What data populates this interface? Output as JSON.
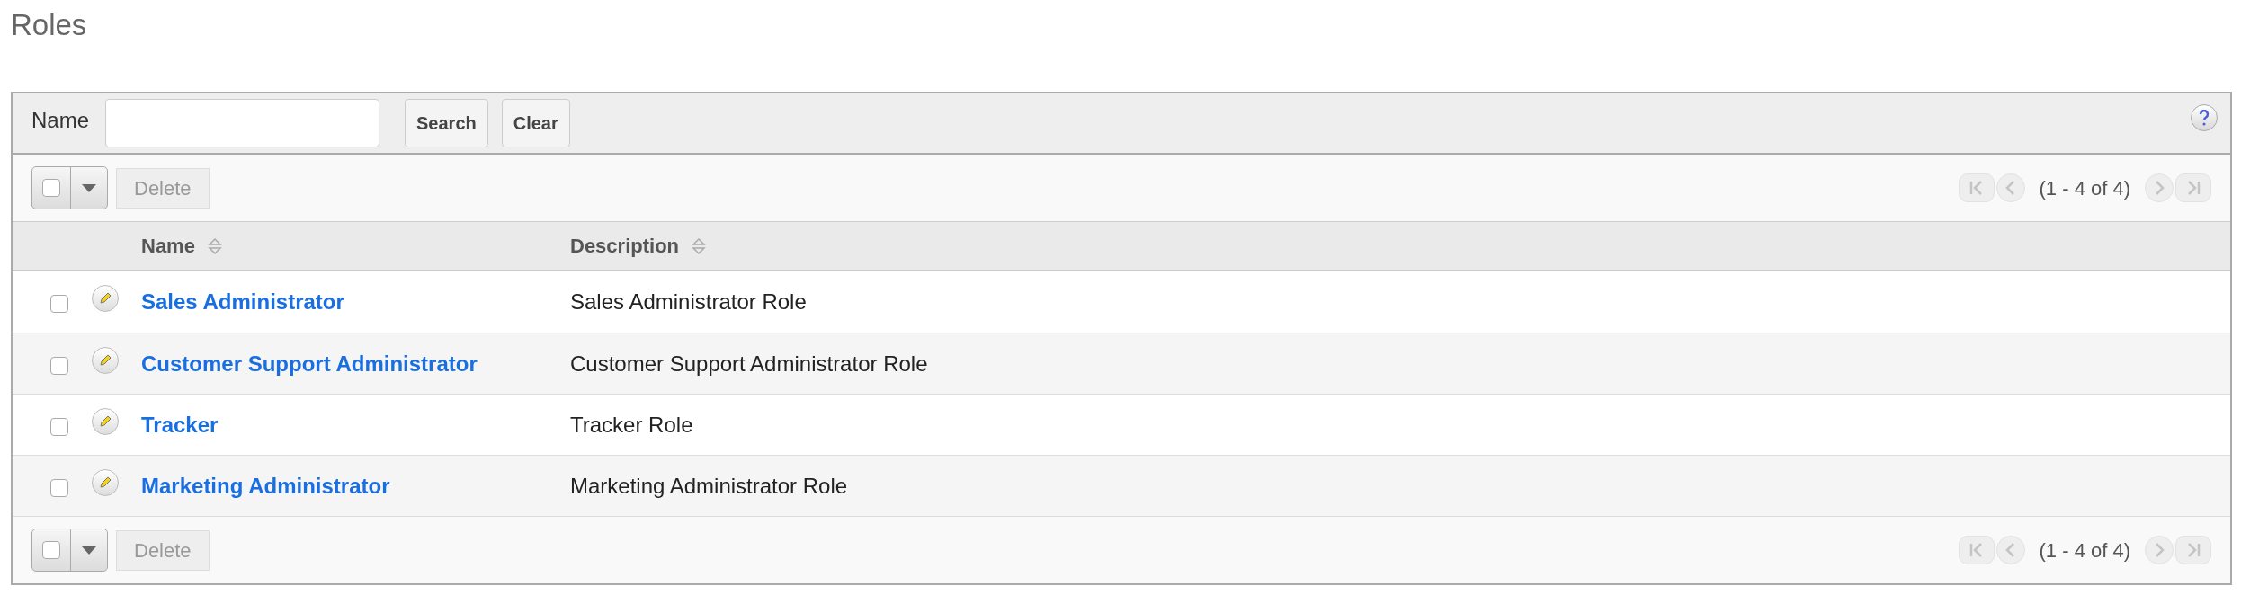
{
  "page_title": "Roles",
  "search": {
    "label": "Name",
    "buttons": [
      "Search",
      "Clear"
    ]
  },
  "toolbars": [
    {
      "select_all": {
        "checked": false
      },
      "delete": {
        "label": "Delete",
        "disabled": true
      },
      "pager": {
        "summary": "(1 - 4 of 4)",
        "first_disabled": true,
        "prev_disabled": true,
        "next_disabled": true,
        "last_disabled": true
      }
    },
    {
      "select_all": {
        "checked": false
      },
      "delete": {
        "label": "Delete",
        "disabled": true
      },
      "pager": {
        "summary": "(1 - 4 of 4)",
        "first_disabled": true,
        "prev_disabled": true,
        "next_disabled": true,
        "last_disabled": true
      }
    }
  ],
  "table": {
    "columns": [
      {
        "label": "Name",
        "sortable": true
      },
      {
        "label": "Description",
        "sortable": true
      }
    ],
    "rows": [
      {
        "name": "Sales Administrator",
        "description": "Sales Administrator Role",
        "checked": false
      },
      {
        "name": "Customer Support Administrator",
        "description": "Customer Support Administrator Role",
        "checked": false
      },
      {
        "name": "Tracker",
        "description": "Tracker Role",
        "checked": false
      },
      {
        "name": "Marketing Administrator",
        "description": "Marketing Administrator Role",
        "checked": false
      }
    ]
  }
}
